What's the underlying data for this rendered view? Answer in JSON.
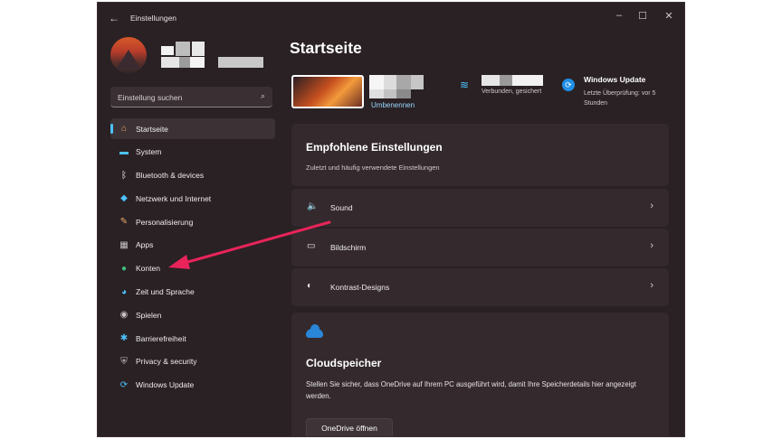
{
  "titlebar": {
    "back_icon": "arrow-left-icon",
    "title": "Einstellungen",
    "minimize": "–",
    "maximize": "☐",
    "close": "✕"
  },
  "search": {
    "placeholder": "Einstellung suchen",
    "icon": "search-icon"
  },
  "sidebar": {
    "items": [
      {
        "label": "Startseite",
        "icon": "home-icon",
        "glyph": "⌂",
        "color": "#f0a868",
        "active": true
      },
      {
        "label": "System",
        "icon": "monitor-icon",
        "glyph": "▬",
        "color": "#4cc2ff"
      },
      {
        "label": "Bluetooth & devices",
        "icon": "bluetooth-icon",
        "glyph": "ᛒ",
        "color": "#ffffff"
      },
      {
        "label": "Netzwerk und Internet",
        "icon": "wifi-icon",
        "glyph": "◆",
        "color": "#4cc2ff"
      },
      {
        "label": "Personalisierung",
        "icon": "brush-icon",
        "glyph": "✎",
        "color": "#f0a868"
      },
      {
        "label": "Apps",
        "icon": "apps-icon",
        "glyph": "▦",
        "color": "#c9c3c5"
      },
      {
        "label": "Konten",
        "icon": "person-icon",
        "glyph": "●",
        "color": "#3fbf7f"
      },
      {
        "label": "Zeit und Sprache",
        "icon": "globe-clock-icon",
        "glyph": "◕",
        "color": "#4cc2ff"
      },
      {
        "label": "Spielen",
        "icon": "gamepad-icon",
        "glyph": "◉",
        "color": "#c9c3c5"
      },
      {
        "label": "Barrierefreiheit",
        "icon": "accessibility-icon",
        "glyph": "✱",
        "color": "#4cc2ff"
      },
      {
        "label": "Privacy & security",
        "icon": "shield-icon",
        "glyph": "⛨",
        "color": "#c9c3c5"
      },
      {
        "label": "Windows Update",
        "icon": "update-icon",
        "glyph": "⟳",
        "color": "#4cc2ff"
      }
    ]
  },
  "main": {
    "title": "Startseite",
    "device": {
      "rename_label": "Umbenennen"
    },
    "network": {
      "status": "Verbunden, gesichert"
    },
    "update": {
      "title": "Windows Update",
      "subtitle": "Letzte Überprüfung: vor 5 Stunden"
    },
    "recommended": {
      "title": "Empfohlene Einstellungen",
      "subtitle": "Zuletzt und häufig verwendete Einstellungen",
      "rows": [
        {
          "label": "Sound",
          "icon": "speaker-icon",
          "glyph": "🔈"
        },
        {
          "label": "Bildschirm",
          "icon": "display-icon",
          "glyph": "▭"
        },
        {
          "label": "Kontrast-Designs",
          "icon": "contrast-icon",
          "glyph": "◐"
        }
      ]
    },
    "cloud": {
      "title": "Cloudspeicher",
      "description": "Stellen Sie sicher, dass OneDrive auf Ihrem PC ausgeführt wird, damit Ihre Speicherdetails hier angezeigt werden.",
      "button": "OneDrive öffnen"
    }
  },
  "colors": {
    "accent": "#4cc2ff",
    "annotation_arrow": "#e8245a",
    "window_bg": "#2a2124"
  }
}
